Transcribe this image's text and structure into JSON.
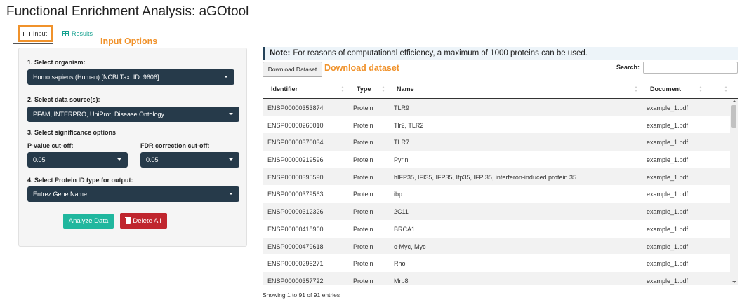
{
  "app": {
    "title": "Functional Enrichment Analysis: aGOtool"
  },
  "tabs": [
    {
      "label": "Input",
      "icon": "keyboard-icon",
      "active": true
    },
    {
      "label": "Results",
      "icon": "table-icon",
      "active": false
    }
  ],
  "annotations": {
    "input_options": "Input Options",
    "download_dataset": "Download dataset"
  },
  "colors": {
    "accent_orange": "#f0922b",
    "select_bg": "#263a4a",
    "analyze_green": "#20b79e",
    "delete_red": "#c0262e",
    "results_teal": "#17a290"
  },
  "form": {
    "organism_label": "1. Select organism:",
    "organism_value": "Homo sapiens (Human) [NCBI Tax. ID: 9606]",
    "source_label": "2. Select data source(s):",
    "source_value": "PFAM, INTERPRO, UniProt, Disease Ontology",
    "significance_label": "3. Select significance options",
    "pvalue_label": "P-value cut-off:",
    "pvalue_value": "0.05",
    "fdr_label": "FDR correction cut-off:",
    "fdr_value": "0.05",
    "idtype_label": "4. Select Protein ID type for output:",
    "idtype_value": "Entrez Gene Name",
    "analyze_label": "Analyze Data",
    "delete_label": "Delete All"
  },
  "note": {
    "prefix": "Note:",
    "text": "For reasons of computational efficiency, a maximum of 1000 proteins can be used."
  },
  "download_label": "Download Dataset",
  "search": {
    "label": "Search:",
    "value": ""
  },
  "table": {
    "headers": [
      "Identifier",
      "Type",
      "Name",
      "Document"
    ],
    "rows": [
      [
        "ENSP00000353874",
        "Protein",
        "TLR9",
        "example_1.pdf"
      ],
      [
        "ENSP00000260010",
        "Protein",
        "Tlr2, TLR2",
        "example_1.pdf"
      ],
      [
        "ENSP00000370034",
        "Protein",
        "TLR7",
        "example_1.pdf"
      ],
      [
        "ENSP00000219596",
        "Protein",
        "Pyrin",
        "example_1.pdf"
      ],
      [
        "ENSP00000395590",
        "Protein",
        "hIFP35, IFI35, IFP35, Ifp35, IFP 35, interferon-induced protein 35",
        "example_1.pdf"
      ],
      [
        "ENSP00000379563",
        "Protein",
        "ibp",
        "example_1.pdf"
      ],
      [
        "ENSP00000312326",
        "Protein",
        "2C11",
        "example_1.pdf"
      ],
      [
        "ENSP00000418960",
        "Protein",
        "BRCA1",
        "example_1.pdf"
      ],
      [
        "ENSP00000479618",
        "Protein",
        "c-Myc, Myc",
        "example_1.pdf"
      ],
      [
        "ENSP00000296271",
        "Protein",
        "Rho",
        "example_1.pdf"
      ],
      [
        "ENSP00000357722",
        "Protein",
        "Mrp8",
        "example_1.pdf"
      ]
    ],
    "info": "Showing 1 to 91 of 91 entries"
  }
}
